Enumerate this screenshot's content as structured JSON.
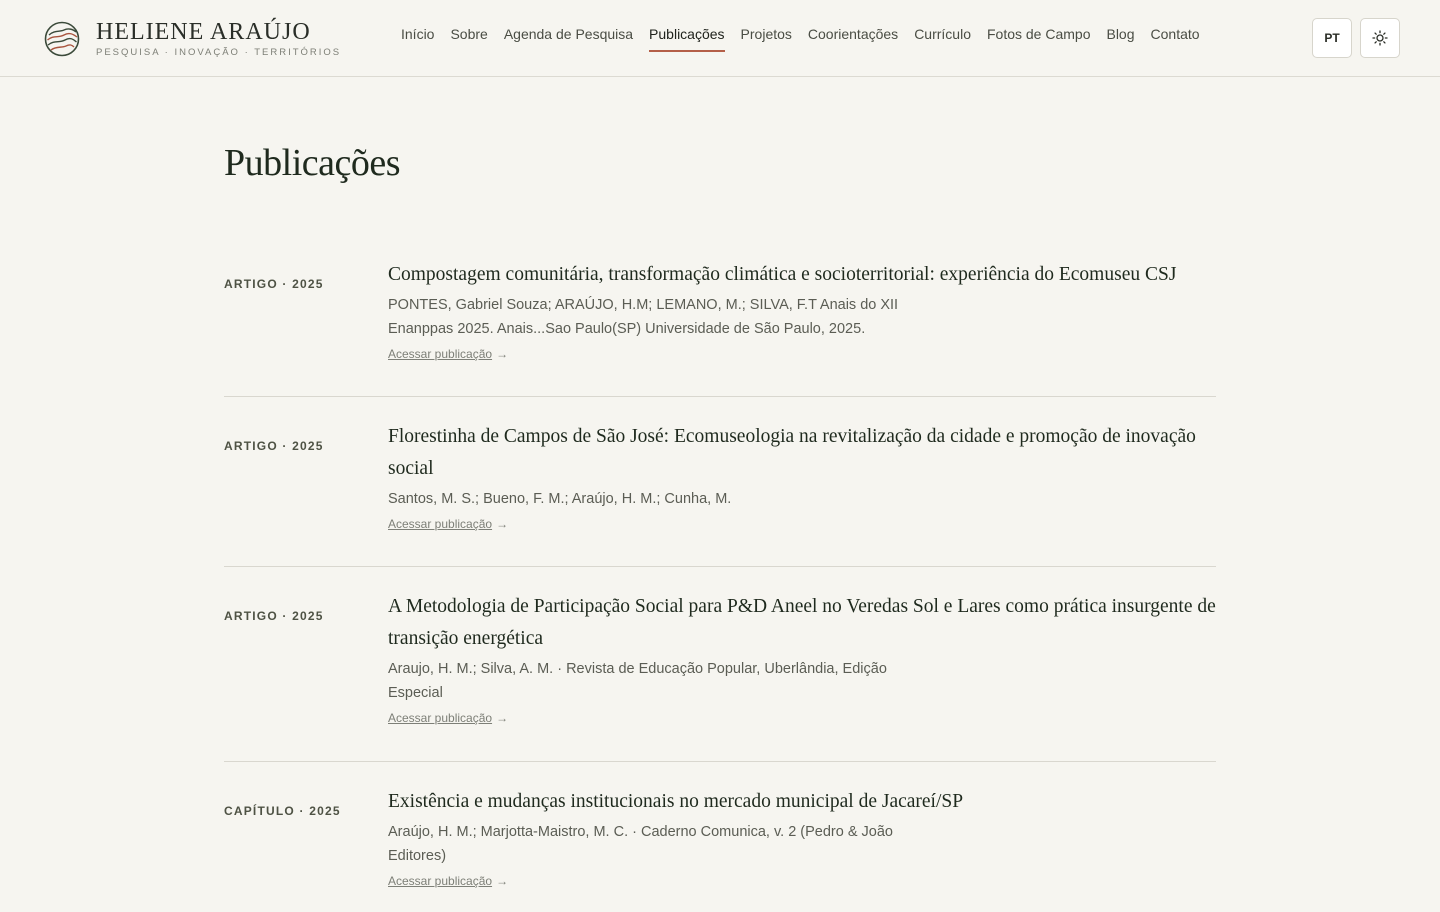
{
  "brand": {
    "name": "HELIENE ARAÚJO",
    "tagline": "PESQUISA · INOVAÇÃO · TERRITÓRIOS"
  },
  "nav": {
    "items": [
      {
        "label": "Início"
      },
      {
        "label": "Sobre"
      },
      {
        "label": "Agenda de Pesquisa"
      },
      {
        "label": "Publicações",
        "active": true
      },
      {
        "label": "Projetos"
      },
      {
        "label": "Coorientações"
      },
      {
        "label": "Currículo"
      },
      {
        "label": "Fotos de Campo"
      },
      {
        "label": "Blog"
      },
      {
        "label": "Contato"
      }
    ]
  },
  "header_controls": {
    "language": "PT",
    "theme_icon": "sun-icon"
  },
  "colors": {
    "accent": "#b45f48",
    "background": "#f6f5f0",
    "title": "#1f2a1e"
  },
  "page": {
    "title": "Publicações"
  },
  "publications": [
    {
      "meta": "ARTIGO · 2025",
      "title": "Compostagem comunitária, transformação climática e socioterritorial: experiência do Ecomuseu CSJ",
      "authors": "PONTES, Gabriel Souza; ARAÚJO, H.M; LEMANO, M.; SILVA, F.T Anais do XII Enanppas 2025. Anais...Sao Paulo(SP) Universidade de São Paulo, 2025.",
      "link": "Acessar publicação"
    },
    {
      "meta": "ARTIGO · 2025",
      "title": "Florestinha de Campos de São José: Ecomuseologia na revitalização da cidade e promoção de inovação social",
      "authors": "Santos, M. S.; Bueno, F. M.; Araújo, H. M.; Cunha, M.",
      "link": "Acessar publicação"
    },
    {
      "meta": "ARTIGO · 2025",
      "title": "A Metodologia de Participação Social para P&D Aneel no Veredas Sol e Lares como prática insurgente de transição energética",
      "authors": "Araujo, H. M.; Silva, A. M. · Revista de Educação Popular, Uberlândia, Edição Especial",
      "link": "Acessar publicação"
    },
    {
      "meta": "CAPÍTULO · 2025",
      "title": "Existência e mudanças institucionais no mercado municipal de Jacareí/SP",
      "authors": "Araújo, H. M.; Marjotta-Maistro, M. C. · Caderno Comunica, v. 2 (Pedro & João Editores)",
      "link": "Acessar publicação"
    }
  ]
}
